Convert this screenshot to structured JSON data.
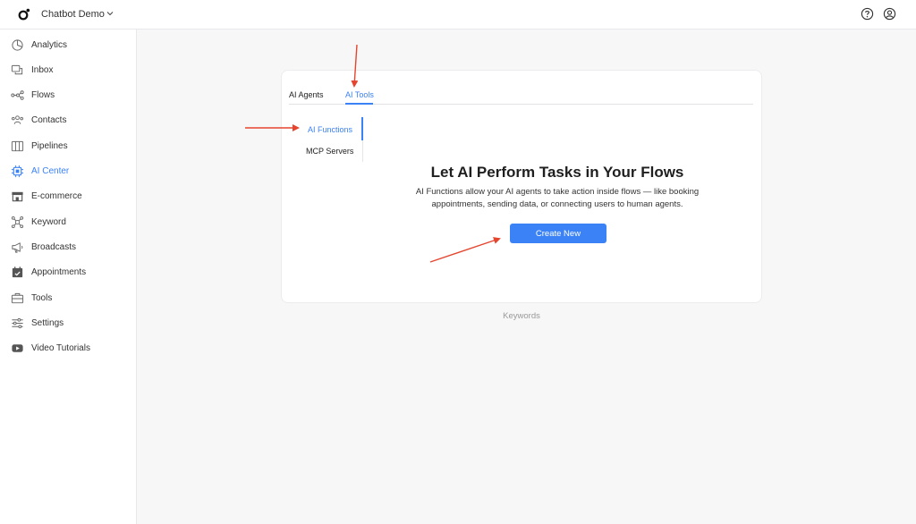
{
  "header": {
    "app_title": "Chatbot Demo",
    "help_icon": "help-circle-icon",
    "account_icon": "user-circle-icon"
  },
  "sidebar": {
    "items": [
      {
        "label": "Analytics",
        "icon": "analytics-icon",
        "active": false
      },
      {
        "label": "Inbox",
        "icon": "inbox-icon",
        "active": false
      },
      {
        "label": "Flows",
        "icon": "flows-icon",
        "active": false
      },
      {
        "label": "Contacts",
        "icon": "contacts-icon",
        "active": false
      },
      {
        "label": "Pipelines",
        "icon": "pipelines-icon",
        "active": false
      },
      {
        "label": "AI Center",
        "icon": "ai-chip-icon",
        "active": true
      },
      {
        "label": "E-commerce",
        "icon": "store-icon",
        "active": false
      },
      {
        "label": "Keyword",
        "icon": "keyword-icon",
        "active": false
      },
      {
        "label": "Broadcasts",
        "icon": "megaphone-icon",
        "active": false
      },
      {
        "label": "Appointments",
        "icon": "calendar-icon",
        "active": false
      },
      {
        "label": "Tools",
        "icon": "toolbox-icon",
        "active": false
      },
      {
        "label": "Settings",
        "icon": "sliders-icon",
        "active": false
      },
      {
        "label": "Video Tutorials",
        "icon": "youtube-icon",
        "active": false
      }
    ]
  },
  "main": {
    "tabs": [
      {
        "label": "AI Agents",
        "active": false
      },
      {
        "label": "AI Tools",
        "active": true
      }
    ],
    "subnav": [
      {
        "label": "AI Functions",
        "active": true
      },
      {
        "label": "MCP Servers",
        "active": false
      }
    ],
    "hero": {
      "title": "Let AI Perform Tasks in Your Flows",
      "description": "AI Functions allow your AI agents to take action inside flows — like booking appointments, sending data, or connecting users to human agents.",
      "create_label": "Create New"
    },
    "footer_label": "Keywords"
  },
  "colors": {
    "accent": "#3b82f6",
    "annotation_arrow": "#e5452e"
  }
}
